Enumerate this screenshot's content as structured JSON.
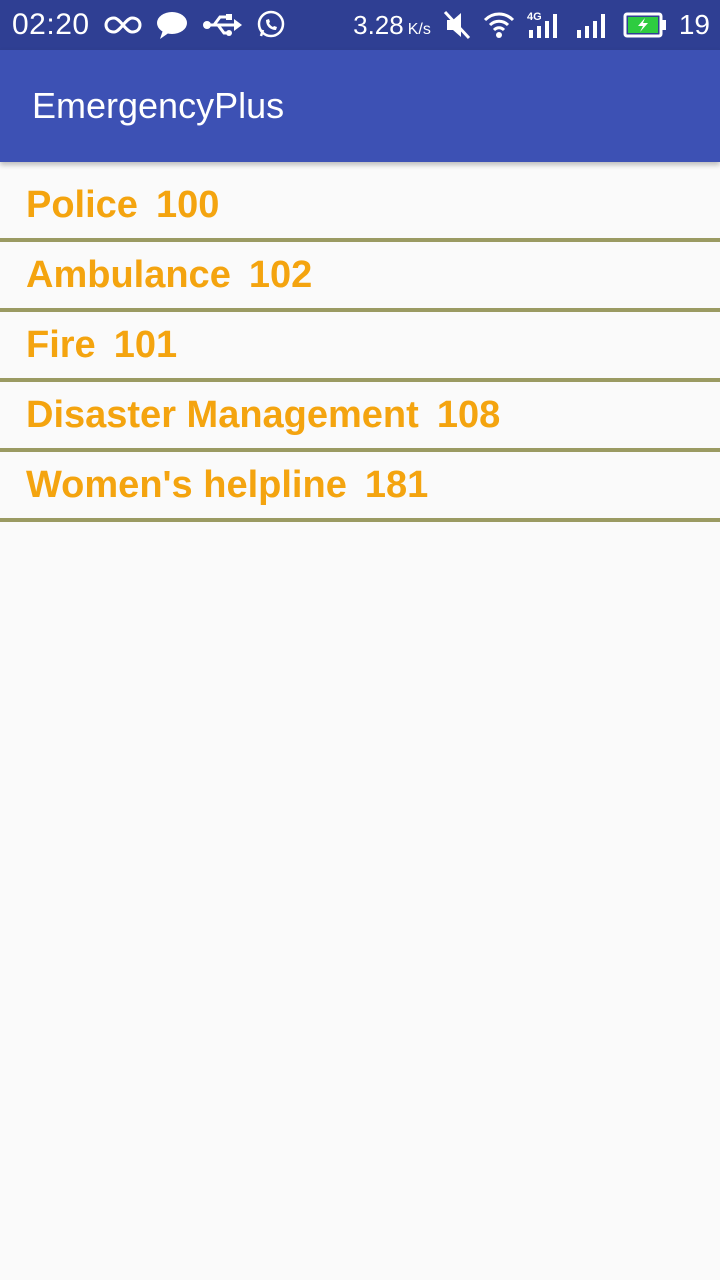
{
  "status_bar": {
    "time": "02:20",
    "speed": "3.28",
    "speed_unit": "K/s",
    "network": "4G",
    "battery_level": "19",
    "icons": [
      "infinity-icon",
      "chat-bubble-icon",
      "usb-icon",
      "whatsapp-icon",
      "mute-icon",
      "wifi-icon",
      "signal-4g-icon",
      "signal-icon",
      "battery-charging-icon"
    ],
    "battery_color": "#2ecc40"
  },
  "app_bar": {
    "title": "EmergencyPlus",
    "color": "#3d51b4"
  },
  "contacts": [
    {
      "name": "Police",
      "number": "100"
    },
    {
      "name": "Ambulance",
      "number": "102"
    },
    {
      "name": "Fire",
      "number": "101"
    },
    {
      "name": "Disaster Management",
      "number": "108"
    },
    {
      "name": "Women's helpline",
      "number": "181"
    }
  ],
  "colors": {
    "item_text": "#f4a40f",
    "divider": "#9a9a62"
  }
}
